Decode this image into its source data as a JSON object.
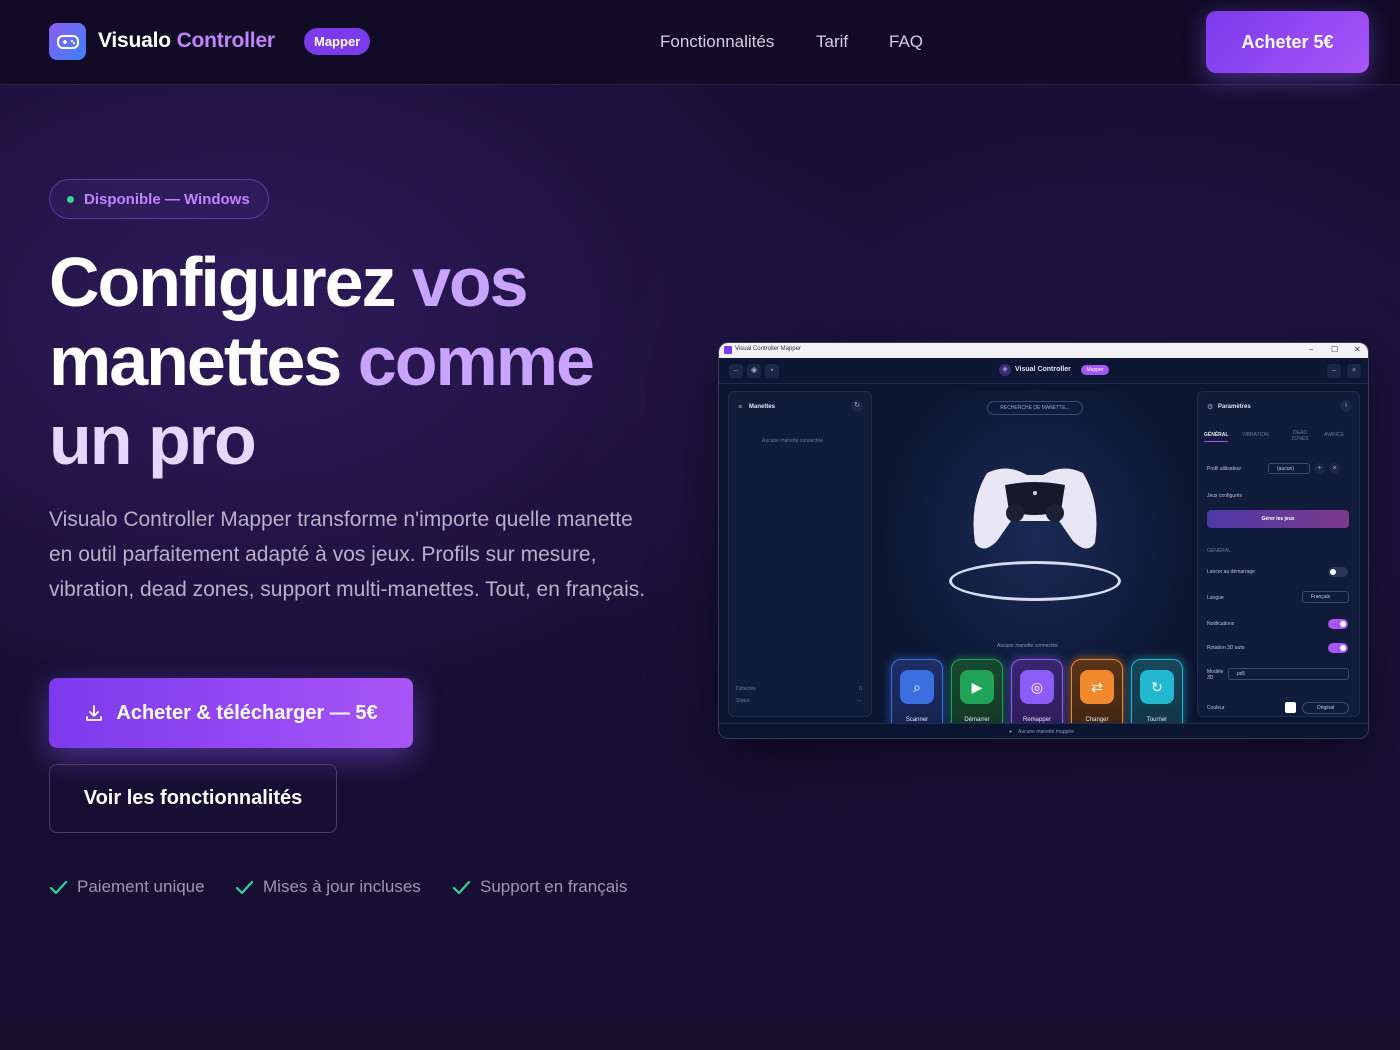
{
  "nav": {
    "brand_part1": "Visualo",
    "brand_part2": "Controller",
    "badge": "Mapper",
    "links": [
      "Fonctionnalités",
      "Tarif",
      "FAQ"
    ],
    "buy_label": "Acheter 5€"
  },
  "hero": {
    "availability": "Disponible — Windows",
    "headline": {
      "line1_white": "Configurez ",
      "line1_purple": "vos",
      "line2_white": "manettes ",
      "line2_purple": "comme",
      "line3": "un pro"
    },
    "lead": "Visualo Controller Mapper transforme n'importe quelle manette en outil parfaitement adapté à vos jeux. Profils sur mesure, vibration, dead zones, support multi-manettes. Tout, en français.",
    "cta_primary": "Acheter & télécharger — 5€",
    "cta_secondary": "Voir les fonctionnalités",
    "perks": [
      "Paiement unique",
      "Mises à jour incluses",
      "Support en français"
    ]
  },
  "app_mock": {
    "window_title": "Visual Controller Mapper",
    "window_controls": [
      "–",
      "☐",
      "✕"
    ],
    "header_brand": "Visual Controller",
    "header_badge": "Mapper",
    "left_panel": {
      "title": "Manettes",
      "empty": "Aucune manette connectée",
      "footer_labels": [
        "Détectée",
        "Statut"
      ],
      "footer_values": [
        "0",
        "—"
      ]
    },
    "center": {
      "search_pill": "RECHERCHE DE MANETTE...",
      "no_controller": "Aucune manette connectée",
      "tiles": [
        {
          "label": "Scanner",
          "icon": "search-icon",
          "color": "#3b6fe0"
        },
        {
          "label": "Démarrer Mapping",
          "icon": "play-icon",
          "color": "#22a35a"
        },
        {
          "label": "Remapper",
          "icon": "gamepad-icon",
          "color": "#8b5cf6"
        },
        {
          "label": "Changer",
          "icon": "swap-icon",
          "color": "#f08a2c"
        },
        {
          "label": "Tourner",
          "icon": "rotate-icon",
          "color": "#22b8cf"
        }
      ]
    },
    "right_panel": {
      "title": "Paramètres",
      "tabs": [
        "GÉNÉRAL",
        "VIBRATION",
        "DEAD ZONES",
        "AVANCÉ"
      ],
      "profile_label": "Profil utilisateur",
      "profile_value": "(aucun)",
      "games_label": "Jeux configurés",
      "games_button": "Gérer les jeux",
      "section": "GÉNÉRAL",
      "settings": [
        {
          "label": "Lancer au démarrage",
          "on": false
        },
        {
          "label": "Notifications",
          "on": true
        },
        {
          "label": "Rotation 3D auto",
          "on": true
        }
      ],
      "language_label": "Langue",
      "language_value": "Français",
      "model_label": "Modèle 3D",
      "model_value": "ps5",
      "color_label": "Couleur",
      "color_value": "Original"
    },
    "status": "Aucune manette mappée"
  }
}
